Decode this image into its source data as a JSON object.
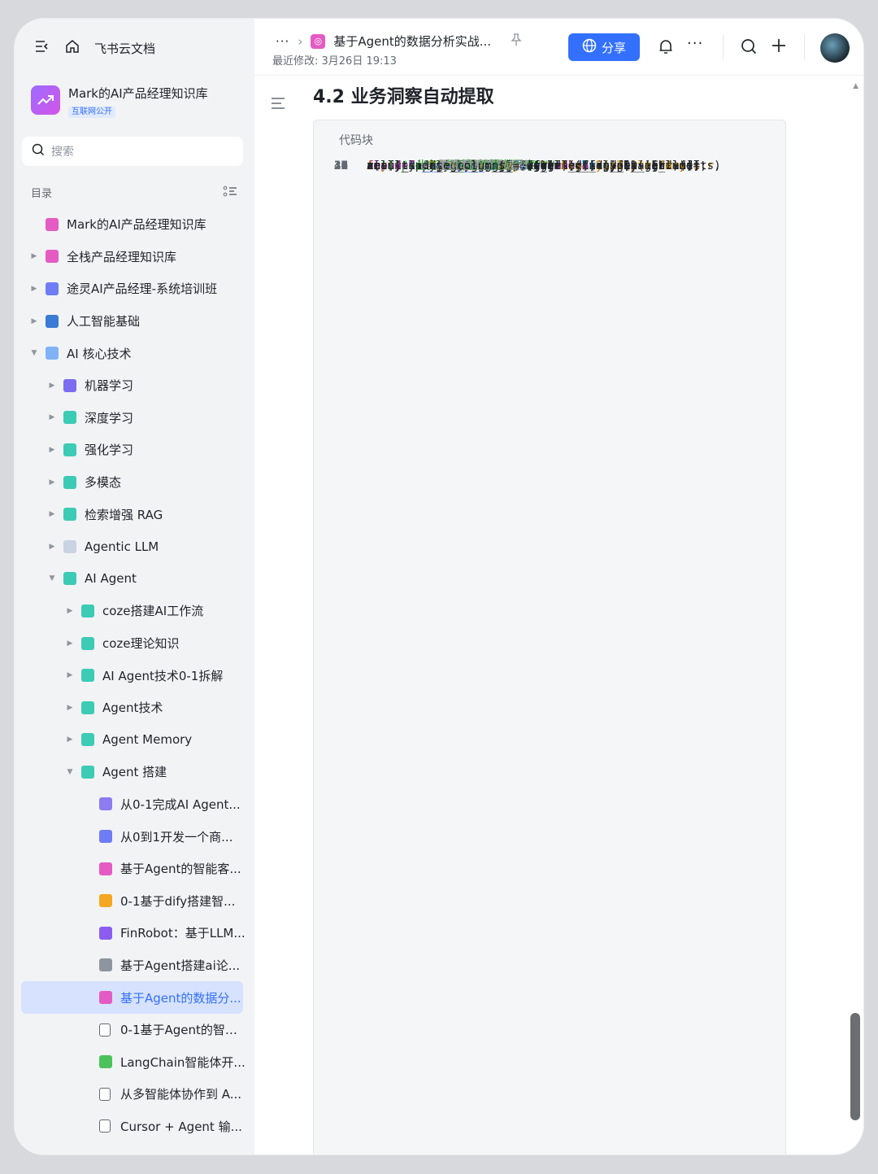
{
  "app": {
    "name": "飞书云文档"
  },
  "kb": {
    "name": "Mark的AI产品经理知识库",
    "badge": "互联网公开"
  },
  "search": {
    "placeholder": "搜索"
  },
  "toc": {
    "title": "目录"
  },
  "tree": [
    {
      "label": "Mark的AI产品经理知识库",
      "level": 0,
      "arrow": "",
      "icon": "#e45bc3"
    },
    {
      "label": "全栈产品经理知识库",
      "level": 0,
      "arrow": "right",
      "icon": "#e45bc3"
    },
    {
      "label": "途灵AI产品经理-系统培训班",
      "level": 0,
      "arrow": "right",
      "icon": "#6e7cf5"
    },
    {
      "label": "人工智能基础",
      "level": 0,
      "arrow": "right",
      "icon": "#3a7bd5"
    },
    {
      "label": "AI 核心技术",
      "level": 0,
      "arrow": "down",
      "icon": "#7fb3f5"
    },
    {
      "label": "机器学习",
      "level": 1,
      "arrow": "right",
      "icon": "#7b6cf0"
    },
    {
      "label": "深度学习",
      "level": 1,
      "arrow": "right",
      "icon": "#3ccbb4"
    },
    {
      "label": "强化学习",
      "level": 1,
      "arrow": "right",
      "icon": "#3ccbb4"
    },
    {
      "label": "多模态",
      "level": 1,
      "arrow": "right",
      "icon": "#3ccbb4"
    },
    {
      "label": "检索增强 RAG",
      "level": 1,
      "arrow": "right",
      "icon": "#3ccbb4"
    },
    {
      "label": "Agentic LLM",
      "level": 1,
      "arrow": "right",
      "icon": "#c9d3e3"
    },
    {
      "label": "AI Agent",
      "level": 1,
      "arrow": "down",
      "icon": "#3ccbb4"
    },
    {
      "label": "coze搭建AI工作流",
      "level": 2,
      "arrow": "right",
      "icon": "#3ccbb4"
    },
    {
      "label": "coze理论知识",
      "level": 2,
      "arrow": "right",
      "icon": "#3ccbb4"
    },
    {
      "label": "AI Agent技术0-1拆解",
      "level": 2,
      "arrow": "right",
      "icon": "#3ccbb4"
    },
    {
      "label": "Agent技术",
      "level": 2,
      "arrow": "right",
      "icon": "#3ccbb4"
    },
    {
      "label": "Agent Memory",
      "level": 2,
      "arrow": "right",
      "icon": "#3ccbb4"
    },
    {
      "label": "Agent 搭建",
      "level": 2,
      "arrow": "down",
      "icon": "#3ccbb4"
    },
    {
      "label": "从0-1完成AI Agent...",
      "level": 3,
      "arrow": "",
      "icon": "#8c7cf0"
    },
    {
      "label": "从0到1开发一个商...",
      "level": 3,
      "arrow": "",
      "icon": "#6e7cf5"
    },
    {
      "label": "基于Agent的智能客...",
      "level": 3,
      "arrow": "",
      "icon": "#e45bc3"
    },
    {
      "label": "0-1基于dify搭建智...",
      "level": 3,
      "arrow": "",
      "icon": "#f5a623"
    },
    {
      "label": "FinRobot：基于LLM...",
      "level": 3,
      "arrow": "",
      "icon": "#8c5cf0"
    },
    {
      "label": "基于Agent搭建ai论...",
      "level": 3,
      "arrow": "",
      "icon": "#8f959e"
    },
    {
      "label": "基于Agent的数据分...",
      "level": 3,
      "arrow": "",
      "icon": "#e45bc3",
      "selected": true
    },
    {
      "label": "0-1基于Agent的智能...",
      "level": 3,
      "arrow": "",
      "icon": "#ffffff"
    },
    {
      "label": "LangChain智能体开...",
      "level": 3,
      "arrow": "",
      "icon": "#4cc35a"
    },
    {
      "label": "从多智能体协作到 A...",
      "level": 3,
      "arrow": "",
      "icon": "#ffffff"
    },
    {
      "label": "Cursor + Agent 输...",
      "level": 3,
      "arrow": "",
      "icon": "#ffffff"
    }
  ],
  "header": {
    "title": "基于Agent的数据分析实战...",
    "modified": "最近修改: 3月26日 19:13",
    "share": "分享"
  },
  "doc": {
    "heading": "4.2 业务洞察自动提取",
    "code_label": "代码块"
  },
  "code": [
    {
      "n": "1",
      "t": "import numpy as np"
    },
    {
      "n": "2",
      "t": "from scipy import stats"
    },
    {
      "n": "3",
      "t": "from typing import List, Dict, Any, Tuple"
    },
    {
      "n": "4",
      "t": ""
    },
    {
      "n": "5",
      "t": "class BusinessInsightExtractor:"
    },
    {
      "n": "6",
      "t": "    \"\"\"业务洞察自动提取器\"\"\""
    },
    {
      "n": "7",
      "t": ""
    },
    {
      "n": "8",
      "t": "    def __init__(self):"
    },
    {
      "n": "9",
      "t": "        self.insight_rules ="
    },
    {
      "n": "",
      "t": "self._load_insight_rules()"
    },
    {
      "n": "10",
      "t": ""
    },
    {
      "n": "11",
      "t": "    def extract_insights(self, df: pd.DataFrame,"
    },
    {
      "n": "",
      "t": "analysis_results: Dict[str, Any]) -> List[Dict[str,"
    },
    {
      "n": "",
      "t": "Any]]:"
    },
    {
      "n": "12",
      "t": "        \"\"\"自动提取业务洞察\"\"\""
    },
    {
      "n": "13",
      "t": "        insights = []"
    },
    {
      "n": "14",
      "t": ""
    },
    {
      "n": "15",
      "t": "        # 趋势分析洞察"
    },
    {
      "n": "16",
      "t": "        trend_insights = self._analyze_trends(df,"
    },
    {
      "n": "",
      "t": "analysis_results)"
    },
    {
      "n": "17",
      "t": "        insights.extend(trend_insights)"
    },
    {
      "n": "18",
      "t": ""
    },
    {
      "n": "19",
      "t": "        # 异常模式洞察"
    },
    {
      "n": "20",
      "t": "        anomaly_insights ="
    },
    {
      "n": "",
      "t": "self._detect_anomaly_patterns(df, analysis_results)"
    },
    {
      "n": "21",
      "t": "        insights.extend(anomaly_insights)"
    },
    {
      "n": "22",
      "t": ""
    },
    {
      "n": "23",
      "t": "        # 相关性洞察"
    },
    {
      "n": "24",
      "t": "        correlation_insights ="
    },
    {
      "n": "",
      "t": "self._extract_correlation_insights(df,"
    },
    {
      "n": "",
      "t": "analysis_results)"
    },
    {
      "n": "25",
      "t": "        insights.extend(correlation_insights)"
    },
    {
      "n": "26",
      "t": ""
    },
    {
      "n": "27",
      "t": "        # 分群洞察"
    },
    {
      "n": "28",
      "t": "        segmentation_insights ="
    },
    {
      "n": "",
      "t": "self._analyze_segmentation(df, analysis_results)"
    },
    {
      "n": "29",
      "t": "        insights.extend(segmentation_insights)"
    },
    {
      "n": "30",
      "t": ""
    },
    {
      "n": "31",
      "t": "        # 按重要性排序"
    },
    {
      "n": "32",
      "t": "        insights.sort(key=lambda x:"
    },
    {
      "n": "",
      "t": "x['importance_score'], reverse=True)"
    },
    {
      "n": "33",
      "t": ""
    },
    {
      "n": "34",
      "t": "        return insights"
    },
    {
      "n": "35",
      "t": ""
    },
    {
      "n": "36",
      "t": "    def _analyze_trends(self, df: pd.DataFrame,"
    },
    {
      "n": "",
      "t": "results: Dict[str, Any]) -> List[Dict[str, Any]]:"
    },
    {
      "n": "37",
      "t": "        \"\"\"分析趋势模式\"\"\""
    },
    {
      "n": "38",
      "t": "        insights = []"
    },
    {
      "n": "39",
      "t": ""
    },
    {
      "n": "40",
      "t": "        # 检测时间序列趋势"
    },
    {
      "n": "41",
      "t": "        date_columns = df.select_dtypes(include="
    }
  ]
}
